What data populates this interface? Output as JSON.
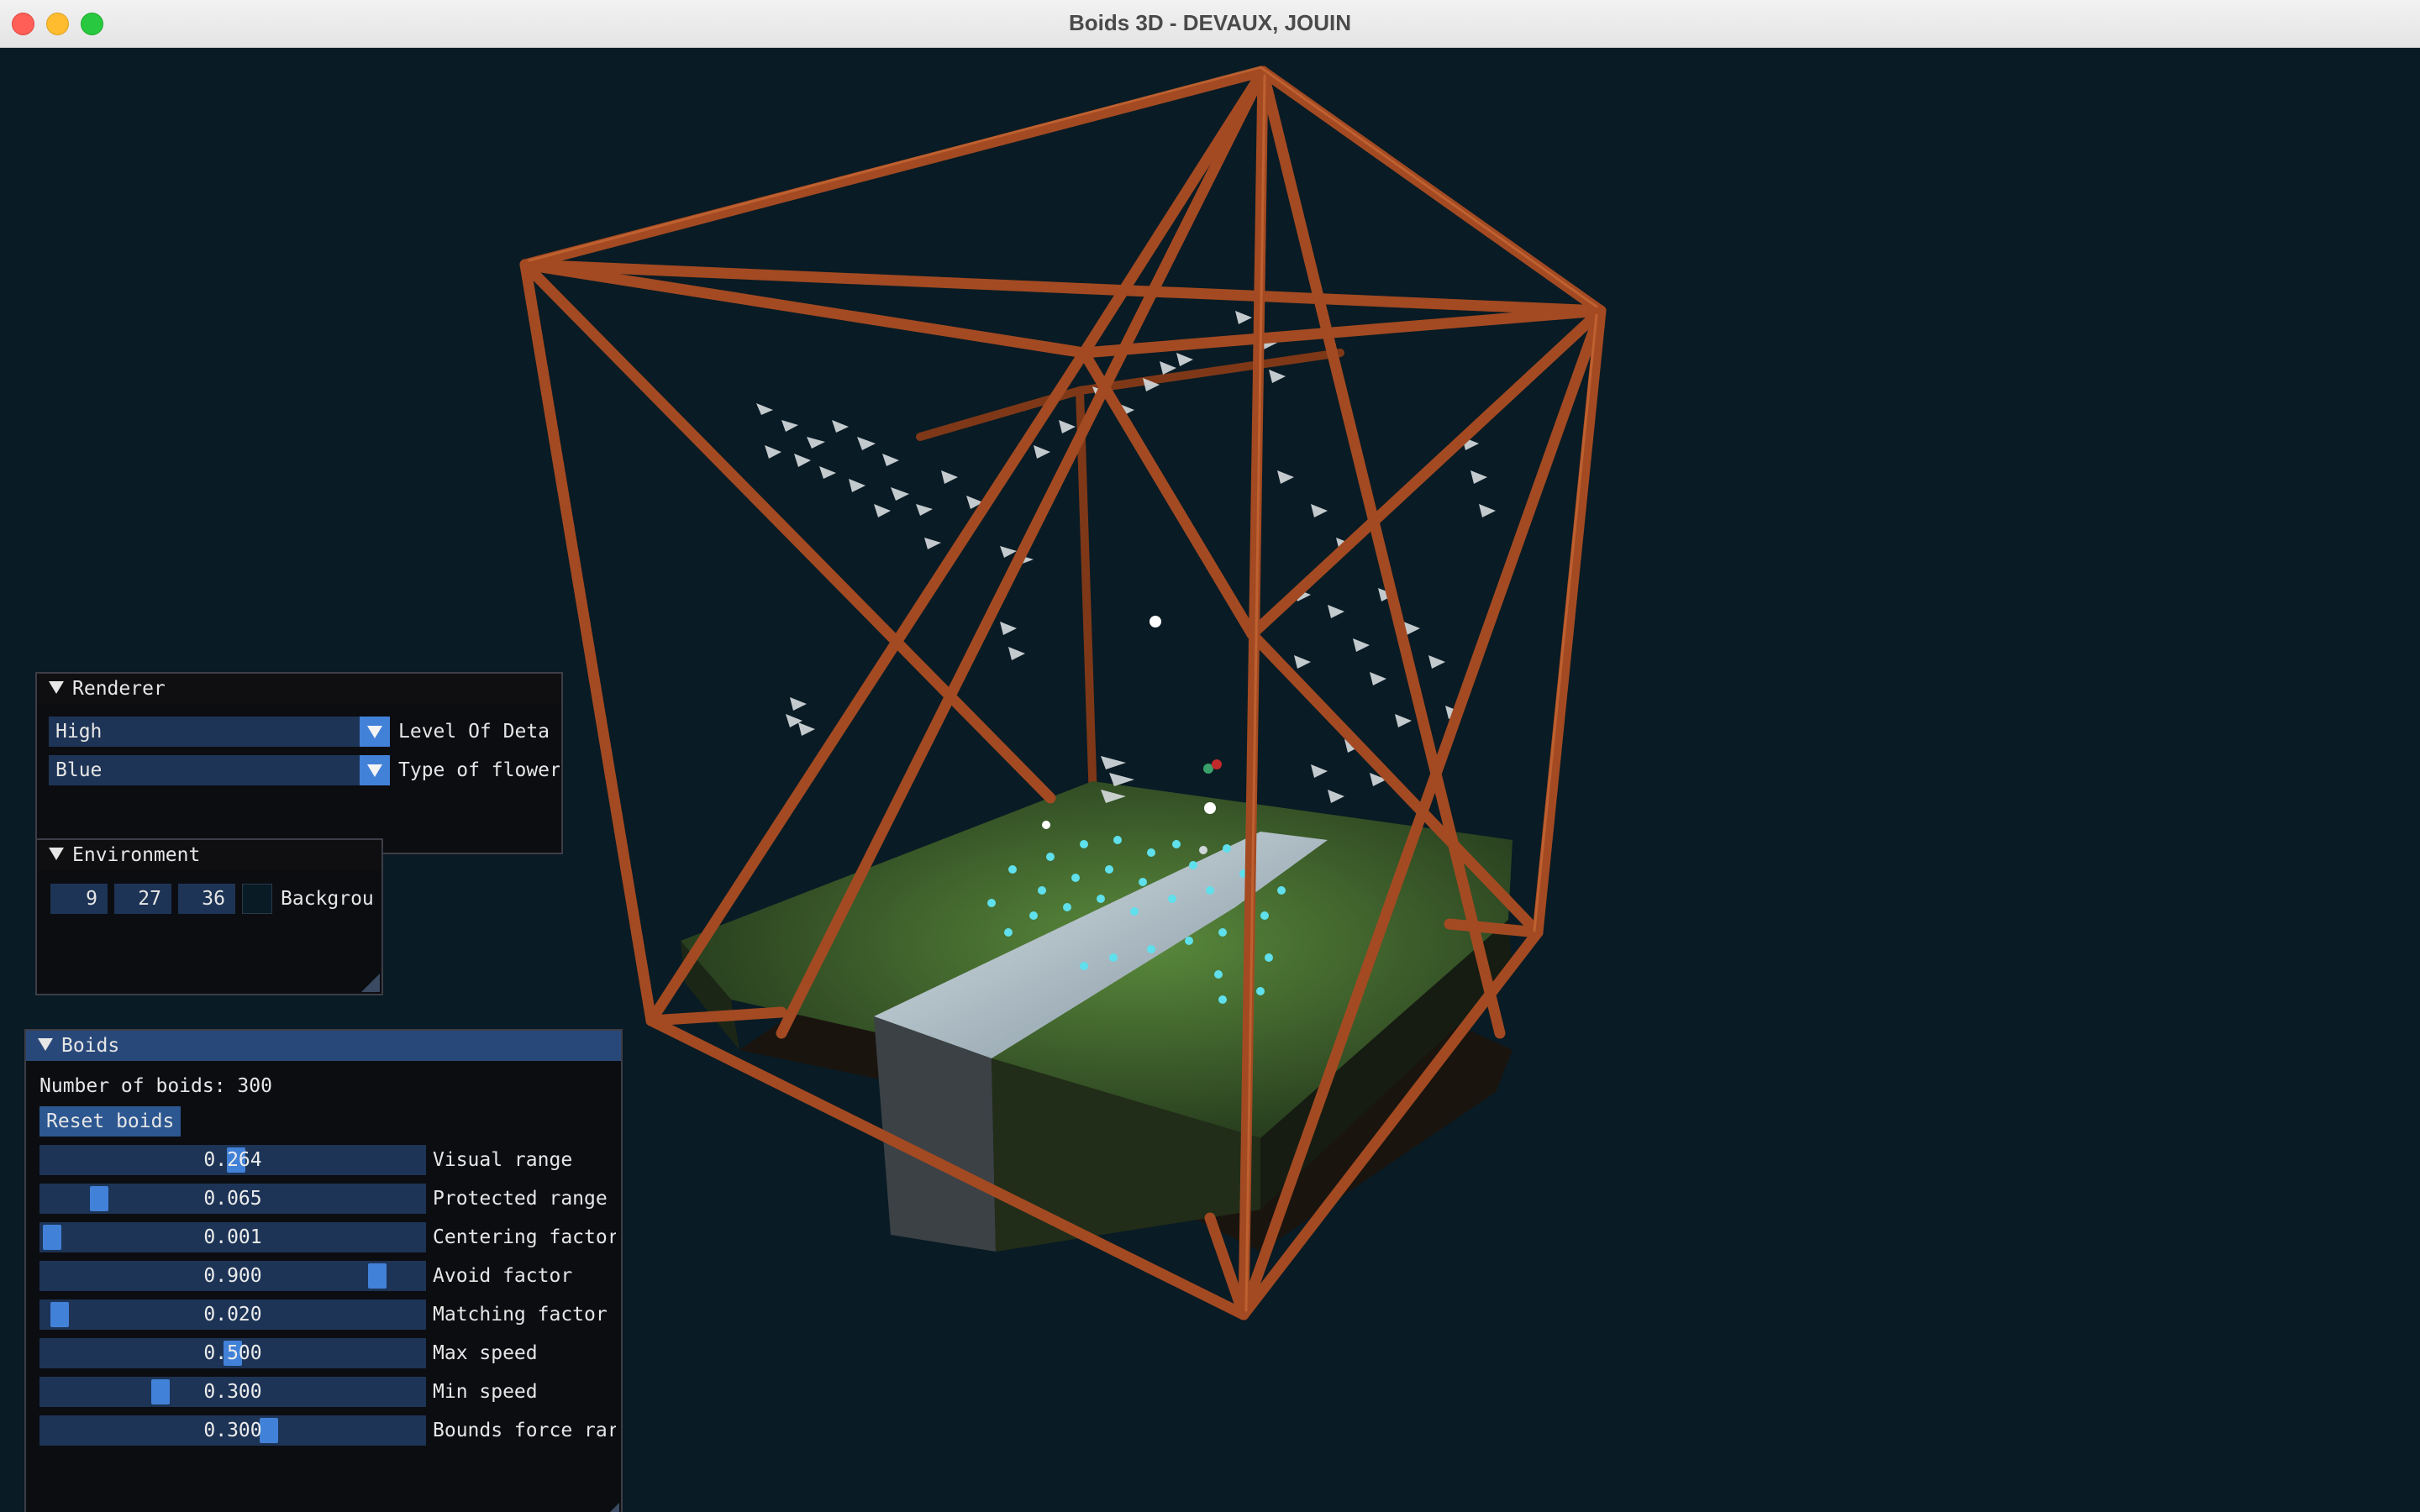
{
  "window": {
    "title": "Boids 3D - DEVAUX, JOUIN"
  },
  "renderer": {
    "header": "Renderer",
    "lod": {
      "value": "High",
      "label": "Level Of Deta"
    },
    "flower": {
      "value": "Blue",
      "label": "Type of flower"
    }
  },
  "environment": {
    "header": "Environment",
    "bg": {
      "r": "9",
      "g": "27",
      "b": "36",
      "label": "Backgrou"
    }
  },
  "boids": {
    "header": "Boids",
    "count_text": "Number of boids: 300",
    "reset_label": "Reset boids",
    "sliders": [
      {
        "label": "Visual range",
        "value": "0.264",
        "fraction": 0.51
      },
      {
        "label": "Protected range",
        "value": "0.065",
        "fraction": 0.13
      },
      {
        "label": "Centering factor",
        "value": "0.001",
        "fraction": 0.0
      },
      {
        "label": "Avoid factor",
        "value": "0.900",
        "fraction": 0.9
      },
      {
        "label": "Matching factor",
        "value": "0.020",
        "fraction": 0.02
      },
      {
        "label": "Max speed",
        "value": "0.500",
        "fraction": 0.5
      },
      {
        "label": "Min speed",
        "value": "0.300",
        "fraction": 0.3
      },
      {
        "label": "Bounds force rar",
        "value": "0.300",
        "fraction": 0.6
      }
    ]
  },
  "colors": {
    "background": "#091b24",
    "frame": "#a34a22",
    "grass": "#3f5a2d",
    "path": "#8fa3ad",
    "flower": "#5fe0ec",
    "slider_knob": "#4281d8",
    "widget_bg": "#1d3456",
    "header_active": "#29487a"
  }
}
